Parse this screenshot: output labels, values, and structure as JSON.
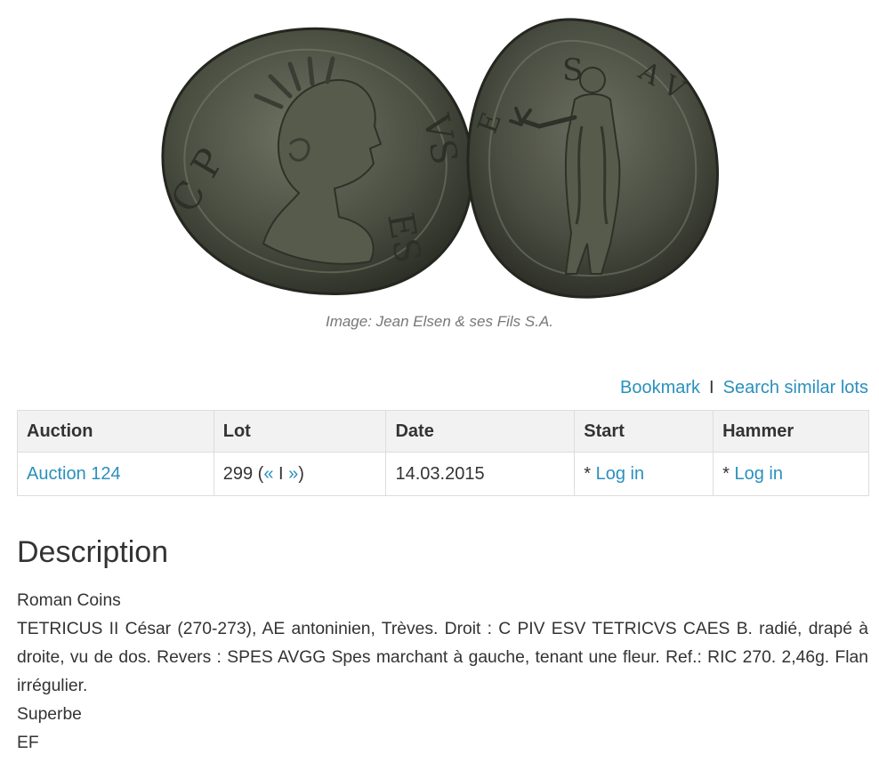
{
  "image": {
    "alt": "coin-obverse-and-reverse",
    "credit": "Image: Jean Elsen & ses Fils S.A."
  },
  "actions": {
    "bookmark": "Bookmark",
    "separator": "I",
    "search_similar": "Search similar lots"
  },
  "table": {
    "headers": {
      "auction": "Auction",
      "lot": "Lot",
      "date": "Date",
      "start": "Start",
      "hammer": "Hammer"
    },
    "row": {
      "auction": "Auction 124",
      "lot_number": "299 (",
      "prev": "«",
      "lot_sep": " I ",
      "next": "»",
      "lot_close": ")",
      "date": "14.03.2015",
      "start_prefix": "* ",
      "start_link": "Log in",
      "hammer_prefix": "* ",
      "hammer_link": "Log in"
    }
  },
  "description": {
    "heading": "Description",
    "category": "Roman Coins",
    "text": "TETRICUS II César (270-273), AE antoninien, Trèves. Droit : C PIV ESV TETRICVS CAES B. radié, drapé à droite, vu de dos. Revers : SPES AVGG Spes marchant à gauche, tenant une fleur. Ref.: RIC 270. 2,46g. Flan irrégulier.",
    "grade_fr": "Superbe",
    "grade_en": "EF"
  }
}
